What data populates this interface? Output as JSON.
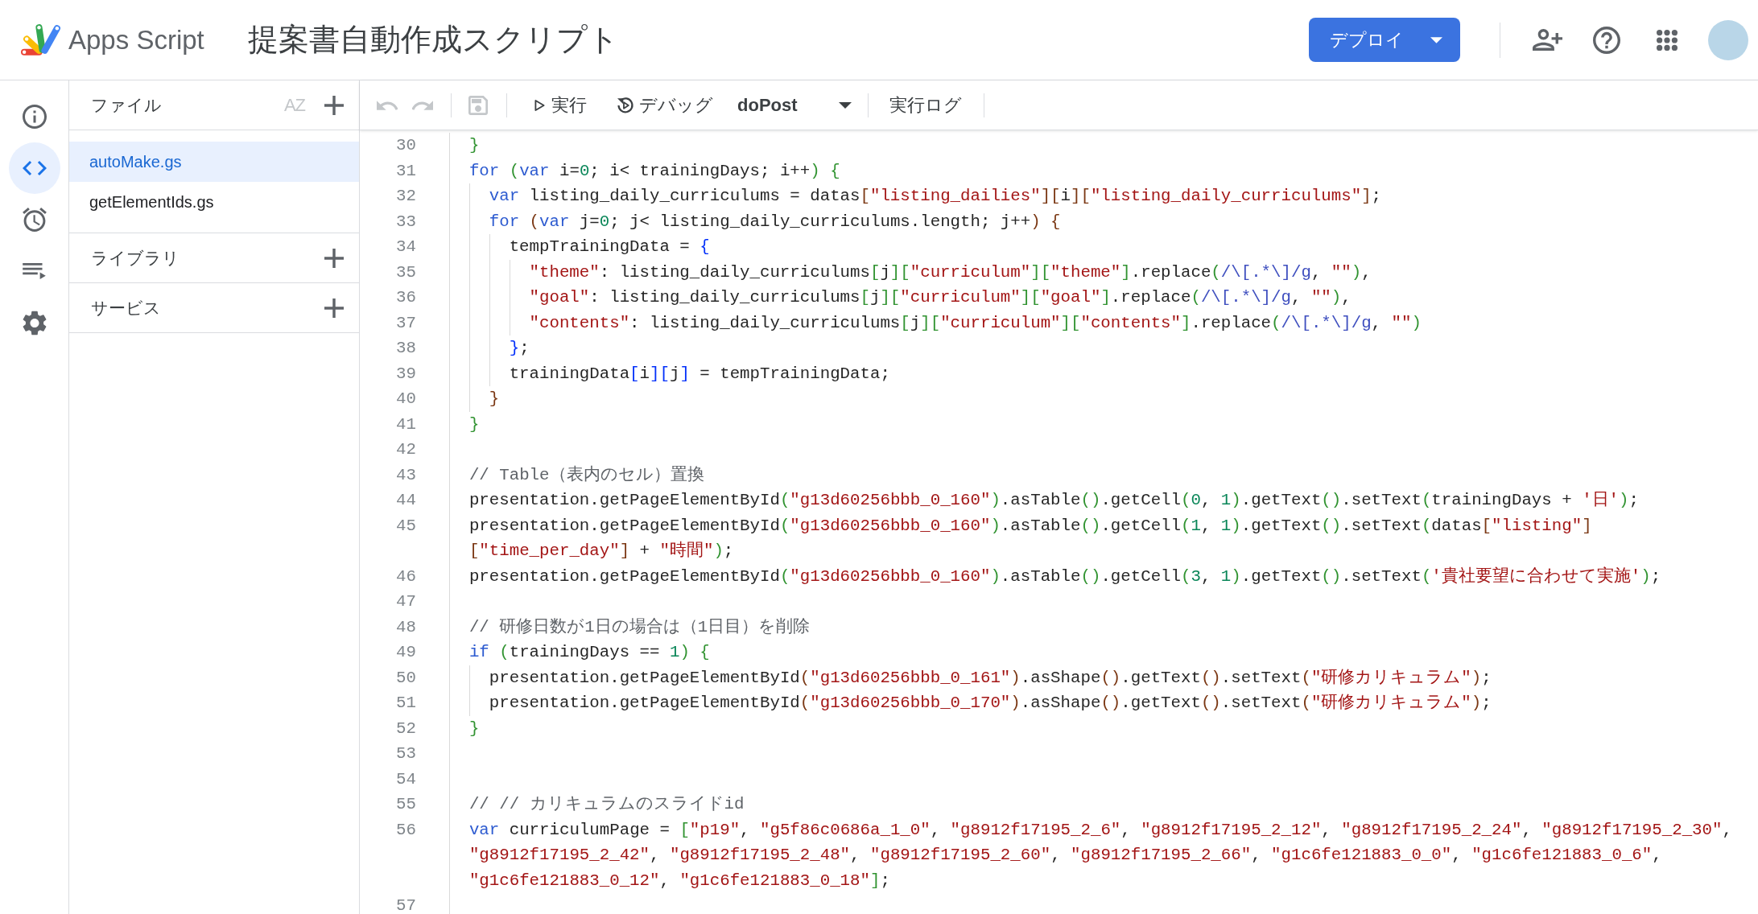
{
  "header": {
    "product": "Apps Script",
    "title": "提案書自動作成スクリプト",
    "deploy_button": {
      "label": "デプロイ"
    }
  },
  "rail": [
    {
      "kind": "overview",
      "selected": false
    },
    {
      "kind": "editor",
      "selected": true
    },
    {
      "kind": "triggers",
      "selected": false
    },
    {
      "kind": "executions",
      "selected": false
    },
    {
      "kind": "settings",
      "selected": false
    }
  ],
  "files_panel": {
    "title": "ファイル",
    "sort_button": {
      "label": "AZ",
      "disabled": true
    },
    "files": [
      {
        "name": "autoMake.gs",
        "selected": true
      },
      {
        "name": "getElementIds.gs",
        "selected": false
      }
    ],
    "sections": [
      {
        "title": "ライブラリ"
      },
      {
        "title": "サービス"
      }
    ]
  },
  "toolbar": {
    "undo": {
      "disabled": true
    },
    "redo": {
      "disabled": true
    },
    "save": {
      "disabled": true
    },
    "run_button": {
      "label": "実行"
    },
    "debug_button": {
      "label": "デバッグ"
    },
    "function_select": {
      "value": "doPost"
    },
    "log_button": {
      "label": "実行ログ"
    }
  },
  "editor": {
    "lines": [
      {
        "number": "30",
        "segments": [
          {
            "tokens": [
              {
                "kind": "bracket",
                "text": "}",
                "color": "#319331"
              }
            ]
          }
        ]
      },
      {
        "number": "31",
        "segments": [
          {
            "tokens": [
              {
                "kind": "keyword",
                "text": "for "
              },
              {
                "kind": "bracket",
                "text": "(",
                "color": "#319331"
              },
              {
                "kind": "keyword",
                "text": "var"
              },
              {
                "kind": "plain",
                "text": " i="
              },
              {
                "kind": "number",
                "text": "0"
              },
              {
                "kind": "plain",
                "text": "; i< trainingDays; i++"
              },
              {
                "kind": "bracket",
                "text": ")",
                "color": "#319331"
              },
              {
                "kind": "bracket",
                "text": " {",
                "color": "#319331"
              }
            ]
          }
        ],
        "children": [
          {
            "number": "32",
            "segments": [
              {
                "tokens": [
                  {
                    "kind": "keyword",
                    "text": "var"
                  },
                  {
                    "kind": "plain",
                    "text": " listing_daily_curriculums = datas"
                  },
                  {
                    "kind": "bracket",
                    "text": "[",
                    "color": "#7b3814"
                  },
                  {
                    "kind": "string",
                    "text": "\"listing_dailies\""
                  },
                  {
                    "kind": "bracket",
                    "text": "]",
                    "color": "#7b3814"
                  },
                  {
                    "kind": "bracket",
                    "text": "[",
                    "color": "#7b3814"
                  },
                  {
                    "kind": "plain",
                    "text": "i"
                  },
                  {
                    "kind": "bracket",
                    "text": "]",
                    "color": "#7b3814"
                  },
                  {
                    "kind": "bracket",
                    "text": "[",
                    "color": "#7b3814"
                  },
                  {
                    "kind": "string",
                    "text": "\"listing_daily_curriculums\""
                  },
                  {
                    "kind": "bracket",
                    "text": "]",
                    "color": "#7b3814"
                  },
                  {
                    "kind": "plain",
                    "text": ";"
                  }
                ]
              }
            ]
          },
          {
            "number": "33",
            "segments": [
              {
                "tokens": [
                  {
                    "kind": "keyword",
                    "text": "for "
                  },
                  {
                    "kind": "bracket",
                    "text": "(",
                    "color": "#7b3814"
                  },
                  {
                    "kind": "keyword",
                    "text": "var"
                  },
                  {
                    "kind": "plain",
                    "text": " j="
                  },
                  {
                    "kind": "number",
                    "text": "0"
                  },
                  {
                    "kind": "plain",
                    "text": "; j< listing_daily_curriculums.length; j++"
                  },
                  {
                    "kind": "bracket",
                    "text": ")",
                    "color": "#7b3814"
                  },
                  {
                    "kind": "bracket",
                    "text": " {",
                    "color": "#7b3814"
                  }
                ]
              }
            ],
            "children": [
              {
                "number": "34",
                "segments": [
                  {
                    "tokens": [
                      {
                        "kind": "plain",
                        "text": "tempTrainingData = "
                      },
                      {
                        "kind": "bracket",
                        "text": "{",
                        "color": "#0431fa"
                      }
                    ]
                  }
                ],
                "children": [
                  {
                    "number": "35",
                    "segments": [
                      {
                        "tokens": [
                          {
                            "kind": "string",
                            "text": "\"theme\""
                          },
                          {
                            "kind": "plain",
                            "text": ": listing_daily_curriculums"
                          },
                          {
                            "kind": "bracket",
                            "text": "[",
                            "color": "#319331"
                          },
                          {
                            "kind": "plain",
                            "text": "j"
                          },
                          {
                            "kind": "bracket",
                            "text": "]",
                            "color": "#319331"
                          },
                          {
                            "kind": "bracket",
                            "text": "[",
                            "color": "#319331"
                          },
                          {
                            "kind": "string",
                            "text": "\"curriculum\""
                          },
                          {
                            "kind": "bracket",
                            "text": "]",
                            "color": "#319331"
                          },
                          {
                            "kind": "bracket",
                            "text": "[",
                            "color": "#319331"
                          },
                          {
                            "kind": "string",
                            "text": "\"theme\""
                          },
                          {
                            "kind": "bracket",
                            "text": "]",
                            "color": "#319331"
                          },
                          {
                            "kind": "plain",
                            "text": ".replace"
                          },
                          {
                            "kind": "bracket",
                            "text": "(",
                            "color": "#319331"
                          },
                          {
                            "kind": "regex",
                            "text": "/\\[.*\\]/g"
                          },
                          {
                            "kind": "plain",
                            "text": ", "
                          },
                          {
                            "kind": "string",
                            "text": "\"\""
                          },
                          {
                            "kind": "bracket",
                            "text": ")",
                            "color": "#319331"
                          },
                          {
                            "kind": "plain",
                            "text": ","
                          }
                        ]
                      }
                    ]
                  },
                  {
                    "number": "36",
                    "segments": [
                      {
                        "tokens": [
                          {
                            "kind": "string",
                            "text": "\"goal\""
                          },
                          {
                            "kind": "plain",
                            "text": ": listing_daily_curriculums"
                          },
                          {
                            "kind": "bracket",
                            "text": "[",
                            "color": "#319331"
                          },
                          {
                            "kind": "plain",
                            "text": "j"
                          },
                          {
                            "kind": "bracket",
                            "text": "]",
                            "color": "#319331"
                          },
                          {
                            "kind": "bracket",
                            "text": "[",
                            "color": "#319331"
                          },
                          {
                            "kind": "string",
                            "text": "\"curriculum\""
                          },
                          {
                            "kind": "bracket",
                            "text": "]",
                            "color": "#319331"
                          },
                          {
                            "kind": "bracket",
                            "text": "[",
                            "color": "#319331"
                          },
                          {
                            "kind": "string",
                            "text": "\"goal\""
                          },
                          {
                            "kind": "bracket",
                            "text": "]",
                            "color": "#319331"
                          },
                          {
                            "kind": "plain",
                            "text": ".replace"
                          },
                          {
                            "kind": "bracket",
                            "text": "(",
                            "color": "#319331"
                          },
                          {
                            "kind": "regex",
                            "text": "/\\[.*\\]/g"
                          },
                          {
                            "kind": "plain",
                            "text": ", "
                          },
                          {
                            "kind": "string",
                            "text": "\"\""
                          },
                          {
                            "kind": "bracket",
                            "text": ")",
                            "color": "#319331"
                          },
                          {
                            "kind": "plain",
                            "text": ","
                          }
                        ]
                      }
                    ]
                  },
                  {
                    "number": "37",
                    "segments": [
                      {
                        "tokens": [
                          {
                            "kind": "string",
                            "text": "\"contents\""
                          },
                          {
                            "kind": "plain",
                            "text": ": listing_daily_curriculums"
                          },
                          {
                            "kind": "bracket",
                            "text": "[",
                            "color": "#319331"
                          },
                          {
                            "kind": "plain",
                            "text": "j"
                          },
                          {
                            "kind": "bracket",
                            "text": "]",
                            "color": "#319331"
                          },
                          {
                            "kind": "bracket",
                            "text": "[",
                            "color": "#319331"
                          },
                          {
                            "kind": "string",
                            "text": "\"curriculum\""
                          },
                          {
                            "kind": "bracket",
                            "text": "]",
                            "color": "#319331"
                          },
                          {
                            "kind": "bracket",
                            "text": "[",
                            "color": "#319331"
                          },
                          {
                            "kind": "string",
                            "text": "\"contents\""
                          },
                          {
                            "kind": "bracket",
                            "text": "]",
                            "color": "#319331"
                          },
                          {
                            "kind": "plain",
                            "text": ".replace"
                          },
                          {
                            "kind": "bracket",
                            "text": "(",
                            "color": "#319331"
                          },
                          {
                            "kind": "regex",
                            "text": "/\\[.*\\]/g"
                          },
                          {
                            "kind": "plain",
                            "text": ", "
                          },
                          {
                            "kind": "string",
                            "text": "\"\""
                          },
                          {
                            "kind": "bracket",
                            "text": ")",
                            "color": "#319331"
                          }
                        ]
                      }
                    ]
                  }
                ]
              },
              {
                "number": "38",
                "segments": [
                  {
                    "tokens": [
                      {
                        "kind": "bracket",
                        "text": "}",
                        "color": "#0431fa"
                      },
                      {
                        "kind": "plain",
                        "text": ";"
                      }
                    ]
                  }
                ]
              },
              {
                "number": "39",
                "segments": [
                  {
                    "tokens": [
                      {
                        "kind": "plain",
                        "text": "trainingData"
                      },
                      {
                        "kind": "bracket",
                        "text": "[",
                        "color": "#0431fa"
                      },
                      {
                        "kind": "plain",
                        "text": "i"
                      },
                      {
                        "kind": "bracket",
                        "text": "]",
                        "color": "#0431fa"
                      },
                      {
                        "kind": "bracket",
                        "text": "[",
                        "color": "#0431fa"
                      },
                      {
                        "kind": "plain",
                        "text": "j"
                      },
                      {
                        "kind": "bracket",
                        "text": "]",
                        "color": "#0431fa"
                      },
                      {
                        "kind": "plain",
                        "text": " = tempTrainingData;"
                      }
                    ]
                  }
                ]
              }
            ]
          },
          {
            "number": "40",
            "segments": [
              {
                "tokens": [
                  {
                    "kind": "bracket",
                    "text": "}",
                    "color": "#7b3814"
                  }
                ]
              }
            ]
          }
        ]
      },
      {
        "number": "41",
        "segments": [
          {
            "tokens": [
              {
                "kind": "bracket",
                "text": "}",
                "color": "#319331"
              }
            ]
          }
        ]
      },
      {
        "number": "42"
      },
      {
        "number": "43",
        "segments": [
          {
            "tokens": [
              {
                "kind": "comment",
                "text": "// Table（表内のセル）置換"
              }
            ]
          }
        ]
      },
      {
        "number": "44",
        "segments": [
          {
            "tokens": [
              {
                "kind": "plain",
                "text": "presentation.getPageElementById"
              },
              {
                "kind": "bracket",
                "text": "(",
                "color": "#319331"
              },
              {
                "kind": "string",
                "text": "\"g13d60256bbb_0_160\""
              },
              {
                "kind": "bracket",
                "text": ")",
                "color": "#319331"
              },
              {
                "kind": "plain",
                "text": ".asTable"
              },
              {
                "kind": "bracket",
                "text": "(",
                "color": "#319331"
              },
              {
                "kind": "bracket",
                "text": ")",
                "color": "#319331"
              },
              {
                "kind": "plain",
                "text": ".getCell"
              },
              {
                "kind": "bracket",
                "text": "(",
                "color": "#319331"
              },
              {
                "kind": "number",
                "text": "0"
              },
              {
                "kind": "plain",
                "text": ", "
              },
              {
                "kind": "number",
                "text": "1"
              },
              {
                "kind": "bracket",
                "text": ")",
                "color": "#319331"
              },
              {
                "kind": "plain",
                "text": ".getText"
              },
              {
                "kind": "bracket",
                "text": "(",
                "color": "#319331"
              },
              {
                "kind": "bracket",
                "text": ")",
                "color": "#319331"
              },
              {
                "kind": "plain",
                "text": ".setText"
              },
              {
                "kind": "bracket",
                "text": "(",
                "color": "#319331"
              },
              {
                "kind": "plain",
                "text": "trainingDays + "
              },
              {
                "kind": "string",
                "text": "'日'"
              },
              {
                "kind": "bracket",
                "text": ")",
                "color": "#319331"
              },
              {
                "kind": "plain",
                "text": ";"
              }
            ]
          }
        ]
      },
      {
        "number": "45",
        "segments": [
          {
            "tokens": [
              {
                "kind": "plain",
                "text": "presentation.getPageElementById"
              },
              {
                "kind": "bracket",
                "text": "(",
                "color": "#319331"
              },
              {
                "kind": "string",
                "text": "\"g13d60256bbb_0_160\""
              },
              {
                "kind": "bracket",
                "text": ")",
                "color": "#319331"
              },
              {
                "kind": "plain",
                "text": ".asTable"
              },
              {
                "kind": "bracket",
                "text": "(",
                "color": "#319331"
              },
              {
                "kind": "bracket",
                "text": ")",
                "color": "#319331"
              },
              {
                "kind": "plain",
                "text": ".getCell"
              },
              {
                "kind": "bracket",
                "text": "(",
                "color": "#319331"
              },
              {
                "kind": "number",
                "text": "1"
              },
              {
                "kind": "plain",
                "text": ", "
              },
              {
                "kind": "number",
                "text": "1"
              },
              {
                "kind": "bracket",
                "text": ")",
                "color": "#319331"
              },
              {
                "kind": "plain",
                "text": ".getText"
              },
              {
                "kind": "bracket",
                "text": "(",
                "color": "#319331"
              },
              {
                "kind": "bracket",
                "text": ")",
                "color": "#319331"
              },
              {
                "kind": "plain",
                "text": ".setText"
              },
              {
                "kind": "bracket",
                "text": "(",
                "color": "#319331"
              },
              {
                "kind": "plain",
                "text": "datas"
              },
              {
                "kind": "bracket",
                "text": "[",
                "color": "#7b3814"
              },
              {
                "kind": "string",
                "text": "\"listing\""
              },
              {
                "kind": "bracket",
                "text": "]",
                "color": "#7b3814"
              }
            ]
          },
          {
            "tokens": [
              {
                "kind": "bracket",
                "text": "[",
                "color": "#7b3814"
              },
              {
                "kind": "string",
                "text": "\"time_per_day\""
              },
              {
                "kind": "bracket",
                "text": "]",
                "color": "#7b3814"
              },
              {
                "kind": "plain",
                "text": " + "
              },
              {
                "kind": "string",
                "text": "\"時間\""
              },
              {
                "kind": "bracket",
                "text": ")",
                "color": "#319331"
              },
              {
                "kind": "plain",
                "text": ";"
              }
            ]
          }
        ]
      },
      {
        "number": "46",
        "segments": [
          {
            "tokens": [
              {
                "kind": "plain",
                "text": "presentation.getPageElementById"
              },
              {
                "kind": "bracket",
                "text": "(",
                "color": "#319331"
              },
              {
                "kind": "string",
                "text": "\"g13d60256bbb_0_160\""
              },
              {
                "kind": "bracket",
                "text": ")",
                "color": "#319331"
              },
              {
                "kind": "plain",
                "text": ".asTable"
              },
              {
                "kind": "bracket",
                "text": "(",
                "color": "#319331"
              },
              {
                "kind": "bracket",
                "text": ")",
                "color": "#319331"
              },
              {
                "kind": "plain",
                "text": ".getCell"
              },
              {
                "kind": "bracket",
                "text": "(",
                "color": "#319331"
              },
              {
                "kind": "number",
                "text": "3"
              },
              {
                "kind": "plain",
                "text": ", "
              },
              {
                "kind": "number",
                "text": "1"
              },
              {
                "kind": "bracket",
                "text": ")",
                "color": "#319331"
              },
              {
                "kind": "plain",
                "text": ".getText"
              },
              {
                "kind": "bracket",
                "text": "(",
                "color": "#319331"
              },
              {
                "kind": "bracket",
                "text": ")",
                "color": "#319331"
              },
              {
                "kind": "plain",
                "text": ".setText"
              },
              {
                "kind": "bracket",
                "text": "(",
                "color": "#319331"
              },
              {
                "kind": "string",
                "text": "'貴社要望に合わせて実施'"
              },
              {
                "kind": "bracket",
                "text": ")",
                "color": "#319331"
              },
              {
                "kind": "plain",
                "text": ";"
              }
            ]
          }
        ]
      },
      {
        "number": "47"
      },
      {
        "number": "48",
        "segments": [
          {
            "tokens": [
              {
                "kind": "comment",
                "text": "// 研修日数が1日の場合は（1日目）を削除"
              }
            ]
          }
        ]
      },
      {
        "number": "49",
        "segments": [
          {
            "tokens": [
              {
                "kind": "keyword",
                "text": "if "
              },
              {
                "kind": "bracket",
                "text": "(",
                "color": "#319331"
              },
              {
                "kind": "plain",
                "text": "trainingDays == "
              },
              {
                "kind": "number",
                "text": "1"
              },
              {
                "kind": "bracket",
                "text": ")",
                "color": "#319331"
              },
              {
                "kind": "bracket",
                "text": " {",
                "color": "#319331"
              }
            ]
          }
        ],
        "children": [
          {
            "number": "50",
            "segments": [
              {
                "tokens": [
                  {
                    "kind": "plain",
                    "text": "presentation.getPageElementById"
                  },
                  {
                    "kind": "bracket",
                    "text": "(",
                    "color": "#7b3814"
                  },
                  {
                    "kind": "string",
                    "text": "\"g13d60256bbb_0_161\""
                  },
                  {
                    "kind": "bracket",
                    "text": ")",
                    "color": "#7b3814"
                  },
                  {
                    "kind": "plain",
                    "text": ".asShape"
                  },
                  {
                    "kind": "bracket",
                    "text": "(",
                    "color": "#7b3814"
                  },
                  {
                    "kind": "bracket",
                    "text": ")",
                    "color": "#7b3814"
                  },
                  {
                    "kind": "plain",
                    "text": ".getText"
                  },
                  {
                    "kind": "bracket",
                    "text": "(",
                    "color": "#7b3814"
                  },
                  {
                    "kind": "bracket",
                    "text": ")",
                    "color": "#7b3814"
                  },
                  {
                    "kind": "plain",
                    "text": ".setText"
                  },
                  {
                    "kind": "bracket",
                    "text": "(",
                    "color": "#7b3814"
                  },
                  {
                    "kind": "string",
                    "text": "\"研修カリキュラム\""
                  },
                  {
                    "kind": "bracket",
                    "text": ")",
                    "color": "#7b3814"
                  },
                  {
                    "kind": "plain",
                    "text": ";"
                  }
                ]
              }
            ]
          },
          {
            "number": "51",
            "segments": [
              {
                "tokens": [
                  {
                    "kind": "plain",
                    "text": "presentation.getPageElementById"
                  },
                  {
                    "kind": "bracket",
                    "text": "(",
                    "color": "#7b3814"
                  },
                  {
                    "kind": "string",
                    "text": "\"g13d60256bbb_0_170\""
                  },
                  {
                    "kind": "bracket",
                    "text": ")",
                    "color": "#7b3814"
                  },
                  {
                    "kind": "plain",
                    "text": ".asShape"
                  },
                  {
                    "kind": "bracket",
                    "text": "(",
                    "color": "#7b3814"
                  },
                  {
                    "kind": "bracket",
                    "text": ")",
                    "color": "#7b3814"
                  },
                  {
                    "kind": "plain",
                    "text": ".getText"
                  },
                  {
                    "kind": "bracket",
                    "text": "(",
                    "color": "#7b3814"
                  },
                  {
                    "kind": "bracket",
                    "text": ")",
                    "color": "#7b3814"
                  },
                  {
                    "kind": "plain",
                    "text": ".setText"
                  },
                  {
                    "kind": "bracket",
                    "text": "(",
                    "color": "#7b3814"
                  },
                  {
                    "kind": "string",
                    "text": "\"研修カリキュラム\""
                  },
                  {
                    "kind": "bracket",
                    "text": ")",
                    "color": "#7b3814"
                  },
                  {
                    "kind": "plain",
                    "text": ";"
                  }
                ]
              }
            ]
          }
        ]
      },
      {
        "number": "52",
        "segments": [
          {
            "tokens": [
              {
                "kind": "bracket",
                "text": "}",
                "color": "#319331"
              }
            ]
          }
        ]
      },
      {
        "number": "53"
      },
      {
        "number": "54"
      },
      {
        "number": "55",
        "segments": [
          {
            "tokens": [
              {
                "kind": "comment",
                "text": "// // カリキュラムのスライドid"
              }
            ]
          }
        ]
      },
      {
        "number": "56",
        "segments": [
          {
            "tokens": [
              {
                "kind": "keyword",
                "text": "var"
              },
              {
                "kind": "plain",
                "text": " curriculumPage = "
              },
              {
                "kind": "bracket",
                "text": "[",
                "color": "#319331"
              },
              {
                "kind": "string",
                "text": "\"p19\""
              },
              {
                "kind": "plain",
                "text": ", "
              },
              {
                "kind": "string",
                "text": "\"g5f86c0686a_1_0\""
              },
              {
                "kind": "plain",
                "text": ", "
              },
              {
                "kind": "string",
                "text": "\"g8912f17195_2_6\""
              },
              {
                "kind": "plain",
                "text": ", "
              },
              {
                "kind": "string",
                "text": "\"g8912f17195_2_12\""
              },
              {
                "kind": "plain",
                "text": ", "
              },
              {
                "kind": "string",
                "text": "\"g8912f17195_2_24\""
              },
              {
                "kind": "plain",
                "text": ", "
              },
              {
                "kind": "string",
                "text": "\"g8912f17195_2_30\""
              },
              {
                "kind": "plain",
                "text": ","
              }
            ]
          },
          {
            "tokens": [
              {
                "kind": "string",
                "text": "\"g8912f17195_2_42\""
              },
              {
                "kind": "plain",
                "text": ", "
              },
              {
                "kind": "string",
                "text": "\"g8912f17195_2_48\""
              },
              {
                "kind": "plain",
                "text": ", "
              },
              {
                "kind": "string",
                "text": "\"g8912f17195_2_60\""
              },
              {
                "kind": "plain",
                "text": ", "
              },
              {
                "kind": "string",
                "text": "\"g8912f17195_2_66\""
              },
              {
                "kind": "plain",
                "text": ", "
              },
              {
                "kind": "string",
                "text": "\"g1c6fe121883_0_0\""
              },
              {
                "kind": "plain",
                "text": ", "
              },
              {
                "kind": "string",
                "text": "\"g1c6fe121883_0_6\""
              },
              {
                "kind": "plain",
                "text": ","
              }
            ]
          },
          {
            "tokens": [
              {
                "kind": "string",
                "text": "\"g1c6fe121883_0_12\""
              },
              {
                "kind": "plain",
                "text": ", "
              },
              {
                "kind": "string",
                "text": "\"g1c6fe121883_0_18\""
              },
              {
                "kind": "bracket",
                "text": "]",
                "color": "#319331"
              },
              {
                "kind": "plain",
                "text": ";"
              }
            ]
          }
        ]
      },
      {
        "number": "57"
      }
    ]
  }
}
